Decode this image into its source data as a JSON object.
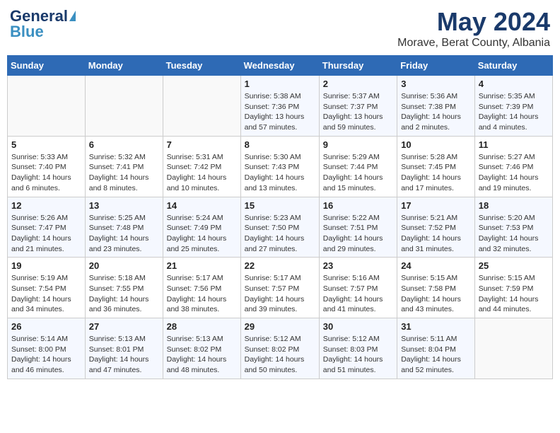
{
  "header": {
    "logo_general": "General",
    "logo_blue": "Blue",
    "month_title": "May 2024",
    "location": "Morave, Berat County, Albania"
  },
  "days_of_week": [
    "Sunday",
    "Monday",
    "Tuesday",
    "Wednesday",
    "Thursday",
    "Friday",
    "Saturday"
  ],
  "weeks": [
    [
      {
        "day": "",
        "info": ""
      },
      {
        "day": "",
        "info": ""
      },
      {
        "day": "",
        "info": ""
      },
      {
        "day": "1",
        "info": "Sunrise: 5:38 AM\nSunset: 7:36 PM\nDaylight: 13 hours\nand 57 minutes."
      },
      {
        "day": "2",
        "info": "Sunrise: 5:37 AM\nSunset: 7:37 PM\nDaylight: 13 hours\nand 59 minutes."
      },
      {
        "day": "3",
        "info": "Sunrise: 5:36 AM\nSunset: 7:38 PM\nDaylight: 14 hours\nand 2 minutes."
      },
      {
        "day": "4",
        "info": "Sunrise: 5:35 AM\nSunset: 7:39 PM\nDaylight: 14 hours\nand 4 minutes."
      }
    ],
    [
      {
        "day": "5",
        "info": "Sunrise: 5:33 AM\nSunset: 7:40 PM\nDaylight: 14 hours\nand 6 minutes."
      },
      {
        "day": "6",
        "info": "Sunrise: 5:32 AM\nSunset: 7:41 PM\nDaylight: 14 hours\nand 8 minutes."
      },
      {
        "day": "7",
        "info": "Sunrise: 5:31 AM\nSunset: 7:42 PM\nDaylight: 14 hours\nand 10 minutes."
      },
      {
        "day": "8",
        "info": "Sunrise: 5:30 AM\nSunset: 7:43 PM\nDaylight: 14 hours\nand 13 minutes."
      },
      {
        "day": "9",
        "info": "Sunrise: 5:29 AM\nSunset: 7:44 PM\nDaylight: 14 hours\nand 15 minutes."
      },
      {
        "day": "10",
        "info": "Sunrise: 5:28 AM\nSunset: 7:45 PM\nDaylight: 14 hours\nand 17 minutes."
      },
      {
        "day": "11",
        "info": "Sunrise: 5:27 AM\nSunset: 7:46 PM\nDaylight: 14 hours\nand 19 minutes."
      }
    ],
    [
      {
        "day": "12",
        "info": "Sunrise: 5:26 AM\nSunset: 7:47 PM\nDaylight: 14 hours\nand 21 minutes."
      },
      {
        "day": "13",
        "info": "Sunrise: 5:25 AM\nSunset: 7:48 PM\nDaylight: 14 hours\nand 23 minutes."
      },
      {
        "day": "14",
        "info": "Sunrise: 5:24 AM\nSunset: 7:49 PM\nDaylight: 14 hours\nand 25 minutes."
      },
      {
        "day": "15",
        "info": "Sunrise: 5:23 AM\nSunset: 7:50 PM\nDaylight: 14 hours\nand 27 minutes."
      },
      {
        "day": "16",
        "info": "Sunrise: 5:22 AM\nSunset: 7:51 PM\nDaylight: 14 hours\nand 29 minutes."
      },
      {
        "day": "17",
        "info": "Sunrise: 5:21 AM\nSunset: 7:52 PM\nDaylight: 14 hours\nand 31 minutes."
      },
      {
        "day": "18",
        "info": "Sunrise: 5:20 AM\nSunset: 7:53 PM\nDaylight: 14 hours\nand 32 minutes."
      }
    ],
    [
      {
        "day": "19",
        "info": "Sunrise: 5:19 AM\nSunset: 7:54 PM\nDaylight: 14 hours\nand 34 minutes."
      },
      {
        "day": "20",
        "info": "Sunrise: 5:18 AM\nSunset: 7:55 PM\nDaylight: 14 hours\nand 36 minutes."
      },
      {
        "day": "21",
        "info": "Sunrise: 5:17 AM\nSunset: 7:56 PM\nDaylight: 14 hours\nand 38 minutes."
      },
      {
        "day": "22",
        "info": "Sunrise: 5:17 AM\nSunset: 7:57 PM\nDaylight: 14 hours\nand 39 minutes."
      },
      {
        "day": "23",
        "info": "Sunrise: 5:16 AM\nSunset: 7:57 PM\nDaylight: 14 hours\nand 41 minutes."
      },
      {
        "day": "24",
        "info": "Sunrise: 5:15 AM\nSunset: 7:58 PM\nDaylight: 14 hours\nand 43 minutes."
      },
      {
        "day": "25",
        "info": "Sunrise: 5:15 AM\nSunset: 7:59 PM\nDaylight: 14 hours\nand 44 minutes."
      }
    ],
    [
      {
        "day": "26",
        "info": "Sunrise: 5:14 AM\nSunset: 8:00 PM\nDaylight: 14 hours\nand 46 minutes."
      },
      {
        "day": "27",
        "info": "Sunrise: 5:13 AM\nSunset: 8:01 PM\nDaylight: 14 hours\nand 47 minutes."
      },
      {
        "day": "28",
        "info": "Sunrise: 5:13 AM\nSunset: 8:02 PM\nDaylight: 14 hours\nand 48 minutes."
      },
      {
        "day": "29",
        "info": "Sunrise: 5:12 AM\nSunset: 8:02 PM\nDaylight: 14 hours\nand 50 minutes."
      },
      {
        "day": "30",
        "info": "Sunrise: 5:12 AM\nSunset: 8:03 PM\nDaylight: 14 hours\nand 51 minutes."
      },
      {
        "day": "31",
        "info": "Sunrise: 5:11 AM\nSunset: 8:04 PM\nDaylight: 14 hours\nand 52 minutes."
      },
      {
        "day": "",
        "info": ""
      }
    ]
  ]
}
